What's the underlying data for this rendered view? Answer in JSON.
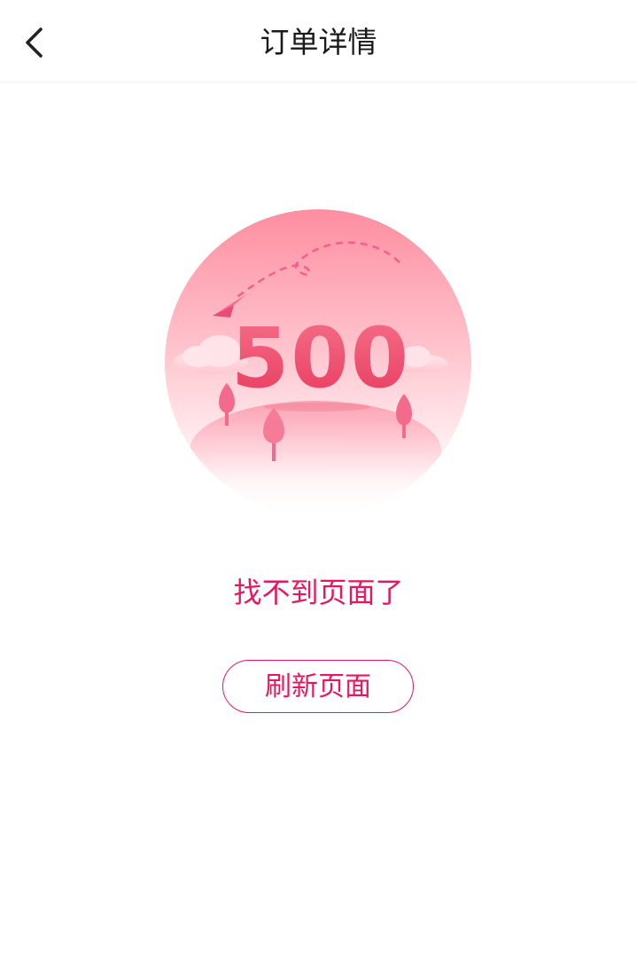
{
  "header": {
    "title": "订单详情",
    "back_icon": "chevron-left-icon"
  },
  "illustration": {
    "code": "500",
    "colors": {
      "circle_top": "#fd8ea0",
      "circle_bottom": "#ffffff",
      "code_text": "#e84b6a",
      "trees": "#f2608a",
      "dashed_path": "#f2608a"
    }
  },
  "message": {
    "text": "找不到页面了",
    "color": "#e8175d"
  },
  "refresh_button": {
    "label": "刷新页面",
    "color": "#e8175d"
  }
}
